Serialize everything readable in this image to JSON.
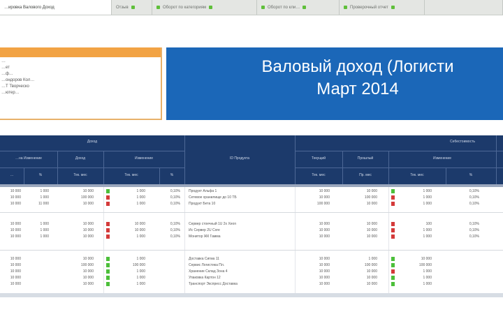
{
  "tabs": [
    {
      "label": "…ировка Валового Доход",
      "active": true
    },
    {
      "label": "Отзыв",
      "active": false
    },
    {
      "label": "Оборот по категориям",
      "active": false
    },
    {
      "label": "Оборот по кли…",
      "active": false
    },
    {
      "label": "Проверочный отчет",
      "active": false
    },
    {
      "label": "",
      "active": false
    }
  ],
  "info": {
    "lines": [
      "…",
      "…ет",
      "…ф…",
      "…ондоров Кол…",
      "…Т Творческо",
      "…ютер…"
    ]
  },
  "banner": {
    "title_line1": "Валовый доход (Логисти",
    "title_line2": "Март 2014"
  },
  "header": {
    "group_left": "Доход",
    "group_right": "Себестоимость",
    "sub_left_a": "…на Изменение",
    "sub_left_b": "Доход",
    "sub_left_c": "Изменение",
    "sub_middle": "ID Продукта",
    "sub_right_a": "Текущий",
    "sub_right_b": "Прошлый",
    "sub_right_c": "Изменение",
    "cols": [
      "…",
      "%",
      "Тек. мес",
      "Тек. мес",
      "%",
      "Тек. мес",
      "Пр. мес",
      "Тек. мес",
      "%"
    ]
  },
  "colors": {
    "header_bg": "#1c3a6b",
    "banner_bg": "#1b67b8",
    "accent_orange": "#f2a344",
    "flag_up": "#4cbf3a",
    "flag_down": "#d43a3a"
  },
  "rows": [
    {
      "a": "10 000",
      "b": "1 000",
      "c": "10 000",
      "flag": "up",
      "d": "1 000",
      "e": "0,10%",
      "prod": "Продукт Альфа 1",
      "f": "10 000",
      "g": "10 000",
      "rflag": "up",
      "h": "1 000",
      "i": "0,10%"
    },
    {
      "a": "10 000",
      "b": "1 000",
      "c": "100 000",
      "flag": "down",
      "d": "1 000",
      "e": "0,10%",
      "prod": "Сетевое хранилище до 10 ТБ",
      "f": "10 000",
      "g": "100 000",
      "rflag": "down",
      "h": "1 000",
      "i": "0,10%"
    },
    {
      "a": "10 000",
      "b": "11 000",
      "c": "10 000",
      "flag": "down",
      "d": "1 000",
      "e": "0,10%",
      "prod": "Продукт Бета 10",
      "f": "100 000",
      "g": "10 000",
      "rflag": "down",
      "h": "1 000",
      "i": "0,10%"
    },
    {
      "a": "10 000",
      "b": "1 000",
      "c": "10 000",
      "flag": "down",
      "d": "10 000",
      "e": "0,10%",
      "prod": "Сервер стоечный 1U 2x Xeon",
      "f": "10 000",
      "g": "10 000",
      "rflag": "down",
      "h": "100",
      "i": "0,10%"
    },
    {
      "a": "10 000",
      "b": "1 000",
      "c": "10 000",
      "flag": "down",
      "d": "10 000",
      "e": "0,10%",
      "prod": "Ис Сервер 2U Core",
      "f": "10 000",
      "g": "10 000",
      "rflag": "down",
      "h": "1 000",
      "i": "0,10%"
    },
    {
      "a": "10 000",
      "b": "1 000",
      "c": "10 000",
      "flag": "down",
      "d": "1 000",
      "e": "0,10%",
      "prod": "Монитор ЖК Гамма",
      "f": "10 000",
      "g": "10 000",
      "rflag": "down",
      "h": "1 000",
      "i": "0,10%"
    },
    {
      "a": "10 000",
      "b": "",
      "c": "10 000",
      "flag": "up",
      "d": "1 000",
      "e": "",
      "prod": "Доставка Сигма 11",
      "f": "10 000",
      "g": "1 000",
      "rflag": "up",
      "h": "10 000",
      "i": ""
    },
    {
      "a": "10 000",
      "b": "",
      "c": "100 000",
      "flag": "up",
      "d": "100 000",
      "e": "",
      "prod": "Сервис Логистика Пл.",
      "f": "10 000",
      "g": "100 000",
      "rflag": "up",
      "h": "100 000",
      "i": ""
    },
    {
      "a": "10 000",
      "b": "",
      "c": "10 000",
      "flag": "up",
      "d": "1 000",
      "e": "",
      "prod": "Хранение Склад Зона 4",
      "f": "10 000",
      "g": "10 000",
      "rflag": "down",
      "h": "1 000",
      "i": ""
    },
    {
      "a": "10 000",
      "b": "",
      "c": "10 000",
      "flag": "up",
      "d": "1 000",
      "e": "",
      "prod": "Упаковка Картон 12",
      "f": "10 000",
      "g": "10 000",
      "rflag": "up",
      "h": "1 000",
      "i": ""
    },
    {
      "a": "10 000",
      "b": "",
      "c": "10 000",
      "flag": "up",
      "d": "1 000",
      "e": "",
      "prod": "Транспорт Экспресс Доставка",
      "f": "10 000",
      "g": "10 000",
      "rflag": "up",
      "h": "1 000",
      "i": ""
    }
  ]
}
